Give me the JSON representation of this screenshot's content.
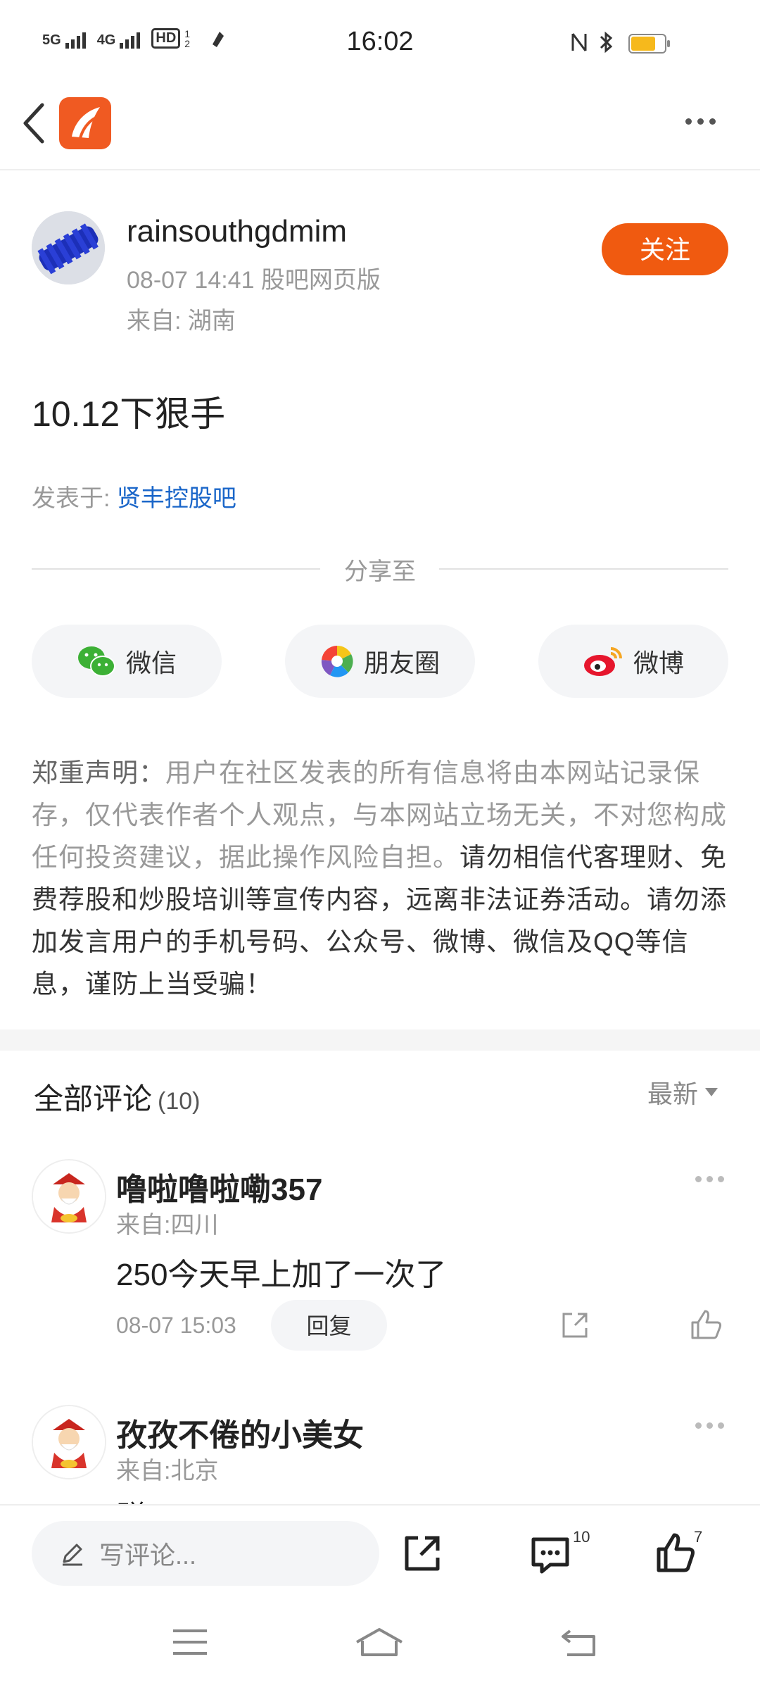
{
  "status_bar": {
    "time": "16:02",
    "network1": "5G",
    "network2": "4G",
    "hd": "HD",
    "hd_sub": "1 2"
  },
  "header": {
    "back_icon": "chevron-left-icon",
    "app_logo": "eastmoney-logo",
    "more_icon": "more-horizontal-icon"
  },
  "post": {
    "author": "rainsouthgdmim",
    "meta": "08-07 14:41 股吧网页版",
    "location": "来自: 湖南",
    "follow_label": "关注",
    "title": "10.12下狠手",
    "posted_in_label": "发表于:",
    "bar_name": "贤丰控股吧"
  },
  "share": {
    "label": "分享至",
    "wechat": "微信",
    "moments": "朋友圈",
    "weibo": "微博"
  },
  "disclaimer": {
    "head": "郑重声明：",
    "body": "用户在社区发表的所有信息将由本网站记录保存，仅代表作者个人观点，与本网站立场无关，不对您构成任何投资建议，据此操作风险自担。",
    "warning": "请勿相信代客理财、免费荐股和炒股培训等宣传内容，远离非法证券活动。请勿添加发言用户的手机号码、公众号、微博、微信及QQ等信息，谨防上当受骗！"
  },
  "comments": {
    "title": "全部评论",
    "count": "(10)",
    "sort": "最新",
    "items": [
      {
        "user": "噜啦噜啦嘞357",
        "location": "来自:四川",
        "text": "250今天早上加了一次了",
        "time": "08-07 15:03",
        "reply": "回复"
      },
      {
        "user": "孜孜不倦的小美女",
        "location": "来自:北京",
        "text": "赚"
      }
    ]
  },
  "bottom_bar": {
    "write_placeholder": "写评论...",
    "comment_count": "10",
    "like_count": "7"
  },
  "colors": {
    "accent": "#f05a10",
    "link": "#1a66c9"
  }
}
